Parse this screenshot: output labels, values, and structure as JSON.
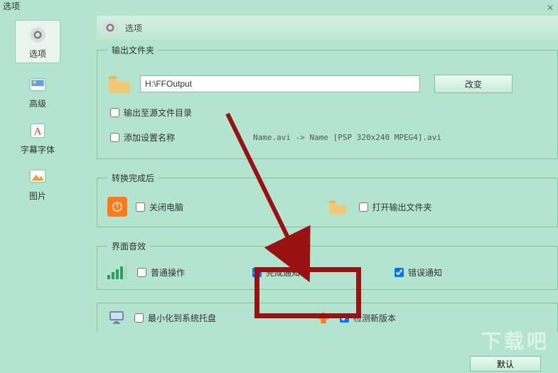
{
  "title": "选项",
  "header_label": "选项",
  "sidebar": {
    "items": [
      {
        "label": "选项"
      },
      {
        "label": "高级"
      },
      {
        "label": "字幕字体"
      },
      {
        "label": "图片"
      }
    ]
  },
  "output": {
    "legend": "输出文件夹",
    "path": "H:\\FFOutput",
    "change_btn": "改变",
    "to_source": "输出至源文件目录",
    "add_setting_name": "添加设置名称",
    "naming_hint": "Name.avi  -> Name [PSP 320x240 MPEG4].avi"
  },
  "after": {
    "legend": "转换完成后",
    "shutdown": "关闭电脑",
    "open_folder": "打开输出文件夹"
  },
  "sound": {
    "legend": "界面音效",
    "normal": "普通操作",
    "done": "完成通知",
    "error": "错误通知"
  },
  "misc": {
    "tray": "最小化到系统托盘",
    "update": "检测新版本"
  },
  "default_btn": "默认",
  "watermark": "下载吧"
}
